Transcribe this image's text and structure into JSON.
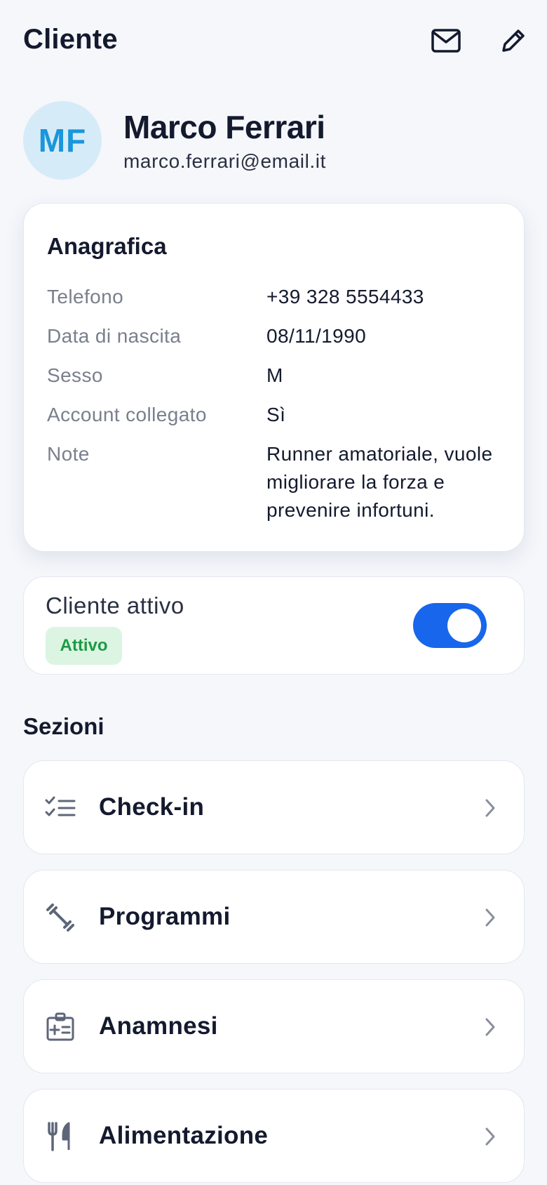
{
  "header": {
    "title": "Cliente",
    "mail_icon": "mail-icon",
    "edit_icon": "pencil-icon"
  },
  "profile": {
    "initials": "MF",
    "name": "Marco Ferrari",
    "email": "marco.ferrari@email.it"
  },
  "info_card": {
    "title": "Anagrafica",
    "rows": [
      {
        "label": "Telefono",
        "value": "+39 328 5554433"
      },
      {
        "label": "Data di nascita",
        "value": "08/11/1990"
      },
      {
        "label": "Sesso",
        "value": "M"
      },
      {
        "label": "Account collegato",
        "value": "Sì"
      },
      {
        "label": "Note",
        "value": "Runner amatoriale, vuole migliorare la forza e prevenire infortuni."
      }
    ]
  },
  "status_card": {
    "label": "Cliente attivo",
    "badge": "Attivo",
    "toggle_on": true
  },
  "sections": {
    "title": "Sezioni",
    "items": [
      {
        "label": "Check-in",
        "icon": "checklist-icon"
      },
      {
        "label": "Programmi",
        "icon": "dumbbell-icon"
      },
      {
        "label": "Anamnesi",
        "icon": "medical-id-icon"
      },
      {
        "label": "Alimentazione",
        "icon": "fork-knife-icon"
      }
    ]
  },
  "colors": {
    "background": "#f5f7fb",
    "accent": "#1766ec",
    "avatar_bg": "#d6ebf8",
    "avatar_text": "#1a96db",
    "badge_bg": "#dcf5e3",
    "badge_text": "#1d9b44",
    "icon_gray": "#5d6679"
  }
}
